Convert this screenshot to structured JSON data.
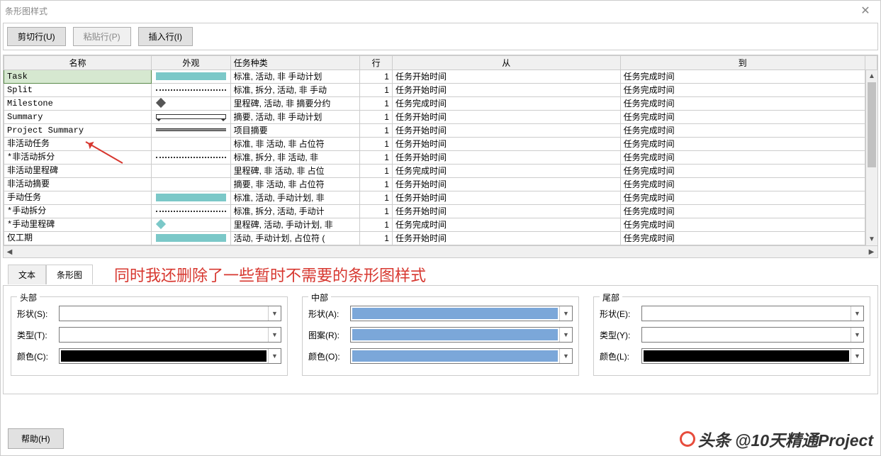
{
  "title": "条形图样式",
  "toolbar": {
    "cut": "剪切行(U)",
    "paste": "粘贴行(P)",
    "insert": "插入行(I)"
  },
  "columns": {
    "name": "名称",
    "appearance": "外观",
    "task_type": "任务种类",
    "row": "行",
    "from": "从",
    "to": "到"
  },
  "rows": [
    {
      "name": "Task",
      "appearance": "solid-teal",
      "task_type": "标准, 活动, 非 手动计划",
      "row": "1",
      "from": "任务开始时间",
      "to": "任务完成时间",
      "selected": true
    },
    {
      "name": "Split",
      "appearance": "dotted",
      "task_type": "标准, 拆分, 活动, 非 手动",
      "row": "1",
      "from": "任务开始时间",
      "to": "任务完成时间"
    },
    {
      "name": "Milestone",
      "appearance": "diamond",
      "task_type": "里程碑, 活动, 非 摘要分约",
      "row": "1",
      "from": "任务完成时间",
      "to": "任务完成时间"
    },
    {
      "name": "Summary",
      "appearance": "summary",
      "task_type": "摘要, 活动, 非 手动计划",
      "row": "1",
      "from": "任务开始时间",
      "to": "任务完成时间"
    },
    {
      "name": "Project Summary",
      "appearance": "summary-gray",
      "task_type": "项目摘要",
      "row": "1",
      "from": "任务开始时间",
      "to": "任务完成时间"
    },
    {
      "name": "非活动任务",
      "appearance": "none",
      "task_type": "标准, 非 活动, 非 占位符",
      "row": "1",
      "from": "任务开始时间",
      "to": "任务完成时间"
    },
    {
      "name": "*非活动拆分",
      "appearance": "dotted",
      "task_type": "标准, 拆分, 非 活动, 非",
      "row": "1",
      "from": "任务开始时间",
      "to": "任务完成时间"
    },
    {
      "name": "非活动里程碑",
      "appearance": "none",
      "task_type": "里程碑, 非 活动, 非 占位",
      "row": "1",
      "from": "任务完成时间",
      "to": "任务完成时间"
    },
    {
      "name": "非活动摘要",
      "appearance": "none",
      "task_type": "摘要, 非 活动, 非 占位符",
      "row": "1",
      "from": "任务开始时间",
      "to": "任务完成时间"
    },
    {
      "name": "手动任务",
      "appearance": "solid-teal",
      "task_type": "标准, 活动, 手动计划, 非",
      "row": "1",
      "from": "任务开始时间",
      "to": "任务完成时间"
    },
    {
      "name": "*手动拆分",
      "appearance": "dotted",
      "task_type": "标准, 拆分, 活动, 手动计",
      "row": "1",
      "from": "任务开始时间",
      "to": "任务完成时间"
    },
    {
      "name": "*手动里程碑",
      "appearance": "diamond-teal",
      "task_type": "里程碑, 活动, 手动计划, 非",
      "row": "1",
      "from": "任务完成时间",
      "to": "任务完成时间"
    },
    {
      "name": "仅工期",
      "appearance": "solid-teal",
      "task_type": "活动, 手动计划, 占位符 (",
      "row": "1",
      "from": "任务开始时间",
      "to": "任务完成时间"
    }
  ],
  "tabs": {
    "text": "文本",
    "bar": "条形图"
  },
  "annotation": "同时我还删除了一些暂时不需要的条形图样式",
  "detail": {
    "head": {
      "legend": "头部",
      "shape": "形状(S):",
      "type": "类型(T):",
      "color": "颜色(C):"
    },
    "mid": {
      "legend": "中部",
      "shape": "形状(A):",
      "pattern": "图案(R):",
      "color": "颜色(O):"
    },
    "tail": {
      "legend": "尾部",
      "shape": "形状(E):",
      "type": "类型(Y):",
      "color": "颜色(L):"
    }
  },
  "help": "帮助(H)",
  "watermark": "头条 @10天精通Project"
}
